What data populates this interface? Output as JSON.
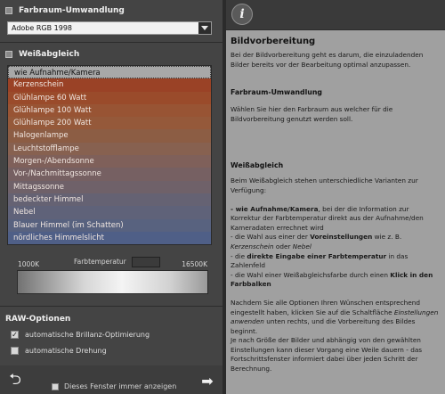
{
  "farbraum": {
    "title": "Farbraum-Umwandlung",
    "selected": "Adobe RGB 1998"
  },
  "weissabgleich": {
    "title": "Weißabgleich",
    "items": [
      {
        "label": "wie Aufnahme/Kamera",
        "color": "#a8a8a8"
      },
      {
        "label": "Kerzenschein",
        "color": "#9a4226"
      },
      {
        "label": "Glühlampe 60 Watt",
        "color": "#9a4b2b"
      },
      {
        "label": "Glühlampe 100 Watt",
        "color": "#985434"
      },
      {
        "label": "Glühlampe 200 Watt",
        "color": "#95593a"
      },
      {
        "label": "Halogenlampe",
        "color": "#8c5d44"
      },
      {
        "label": "Leuchtstofflampe",
        "color": "#876150"
      },
      {
        "label": "Morgen-/Abendsonne",
        "color": "#7f605a"
      },
      {
        "label": "Vor-/Nachmittagssonne",
        "color": "#766062"
      },
      {
        "label": "Mittagssonne",
        "color": "#6f6169"
      },
      {
        "label": "bedeckter Himmel",
        "color": "#656273"
      },
      {
        "label": "Nebel",
        "color": "#5f6279"
      },
      {
        "label": "Blauer Himmel (im Schatten)",
        "color": "#58627f"
      },
      {
        "label": "nördliches Himmelslicht",
        "color": "#4f5f87"
      }
    ],
    "temp_min": "1000K",
    "temp_label": "Farbtemperatur",
    "temp_max": "16500K"
  },
  "raw": {
    "title": "RAW-Optionen",
    "option1_label": "automatische Brillanz-Optimierung",
    "option1_checked": true,
    "option2_label": "automatische Drehung",
    "option2_checked": false
  },
  "footer": {
    "dont_show_label": "Dieses Fenster immer anzeigen",
    "back_icon": "undo-arrow-icon",
    "forward_icon": "right-arrow-icon"
  },
  "info": {
    "button": "i",
    "title": "Bildvorbereitung",
    "intro": "Bei der Bildvorbereitung geht es darum, die einzuladenden Bilder bereits vor der Bearbeitung optimal anzupassen.",
    "h1": "Farbraum-Umwandlung",
    "p1": "Wählen Sie hier den Farbraum aus welcher für die Bildvorbereitung genutzt werden soll.",
    "h2": "Weißabgleich",
    "p2": "Beim Weißabgleich stehen unterschiedliche Varianten zur Verfügung:",
    "b1_bold": "- wie Aufnahme/Kamera",
    "b1_rest": ", bei der die Information zur Korrektur der Farbtemperatur direkt aus der Aufnahme/den Kameradaten errechnet wird",
    "b2_a": "- die Wahl aus einer der ",
    "b2_bold": "Voreinstellungen",
    "b2_b": " wie z. B. ",
    "b2_i1": "Kerzenschein",
    "b2_c": " oder ",
    "b2_i2": "Nebel",
    "b3_a": "- die ",
    "b3_bold": "direkte Eingabe einer Farbtemperatur",
    "b3_b": " in das Zahlenfeld",
    "b4_a": "- die Wahl einer Weißabgleichsfarbe durch einen ",
    "b4_bold": "Klick in den Farbbalken",
    "p3_a": "Nachdem Sie alle Optionen Ihren Wünschen entsprechend eingestellt haben, klicken Sie auf die Schaltfläche ",
    "p3_i": "Einstellungen anwenden",
    "p3_b": " unten rechts, und die Vorbereitung des Bildes beginnt.",
    "p4": "Je nach Größe der Bilder und abhängig von den gewählten Einstellungen kann dieser Vorgang eine Weile dauern - das Fortschrittsfenster informiert dabei über jeden Schritt der Berechnung."
  }
}
